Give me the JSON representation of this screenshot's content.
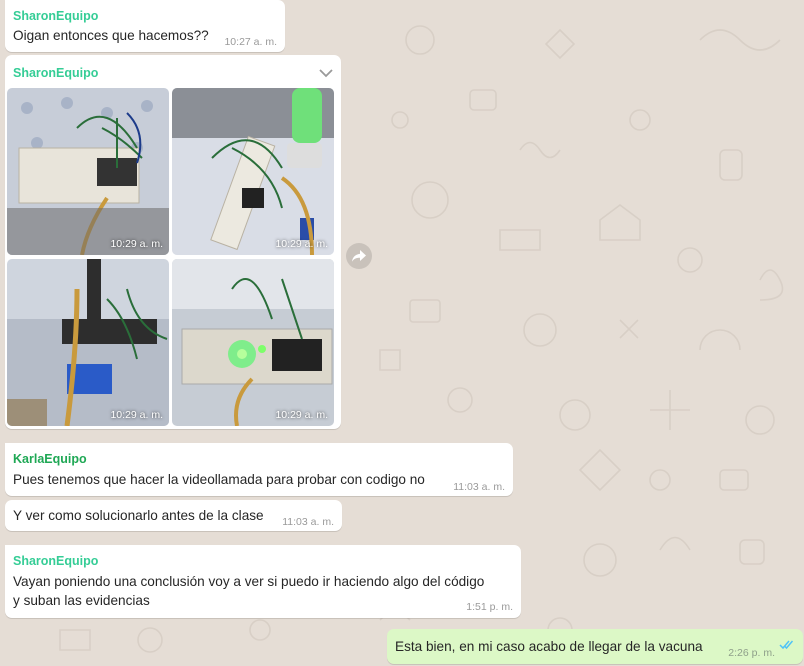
{
  "colors": {
    "background": "#e5ddd5",
    "incoming_bubble": "#ffffff",
    "outgoing_bubble": "#dcf8c6",
    "sharon_name": "#35cd96",
    "karla_name": "#1fa855",
    "read_ticks": "#4fc3f7"
  },
  "messages": [
    {
      "sender": "SharonEquipo",
      "text": "Oigan entonces que hacemos??",
      "time": "10:27 a. m."
    },
    {
      "sender": "SharonEquipo",
      "type": "photo-album",
      "photos": [
        {
          "time": "10:29 a. m.",
          "icon": "breadboard-photo"
        },
        {
          "time": "10:29 a. m.",
          "icon": "breadboard-photo"
        },
        {
          "time": "10:29 a. m.",
          "icon": "relay-photo"
        },
        {
          "time": "10:29 a. m.",
          "icon": "green-led-photo"
        }
      ]
    },
    {
      "sender": "KarlaEquipo",
      "text": "Pues tenemos que hacer la videollamada para probar con codigo no",
      "time": "11:03 a. m."
    },
    {
      "text": "Y ver como solucionarlo antes de la clase",
      "time": "11:03 a. m."
    },
    {
      "sender": "SharonEquipo",
      "text_line1": "Vayan poniendo una conclusión voy a ver si puedo ir haciendo algo del código",
      "text_line2": "y suban las evidencias",
      "time": "1:51 p. m."
    },
    {
      "outgoing": true,
      "text": "Esta bien, en mi caso acabo de llegar de la vacuna",
      "time": "2:26 p. m.",
      "status": "read"
    }
  ]
}
